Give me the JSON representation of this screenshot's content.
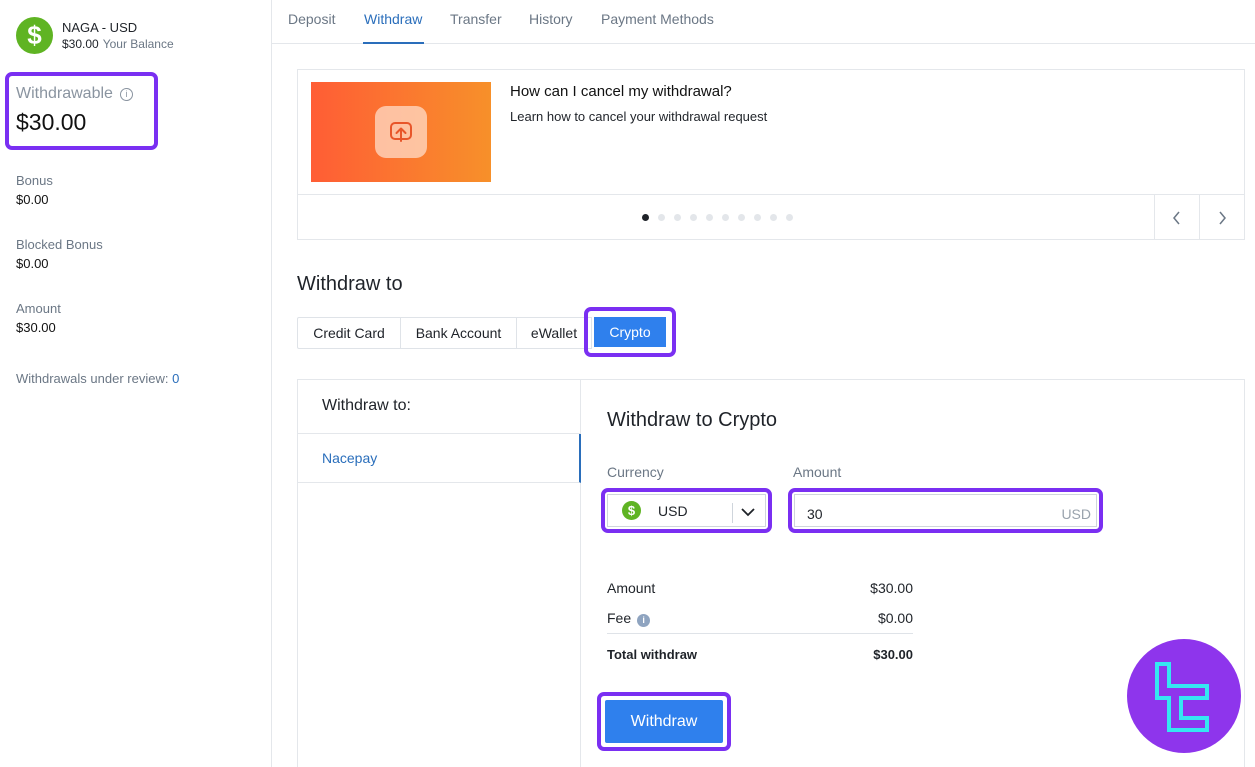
{
  "sidebar": {
    "account_name": "NAGA - USD",
    "balance": "$30.00",
    "balance_label": "Your Balance",
    "withdrawable_label": "Withdrawable",
    "withdrawable_value": "$30.00",
    "bonus_label": "Bonus",
    "bonus_value": "$0.00",
    "blocked_label": "Blocked Bonus",
    "blocked_value": "$0.00",
    "amount_label": "Amount",
    "amount_value": "$30.00",
    "review_label": "Withdrawals under review:",
    "review_count": "0"
  },
  "tabs": [
    "Deposit",
    "Withdraw",
    "Transfer",
    "History",
    "Payment Methods"
  ],
  "active_tab": "Withdraw",
  "carousel": {
    "title": "How can I cancel my withdrawal?",
    "subtitle": "Learn how to cancel your withdrawal request",
    "page_count": 10,
    "current_page": 1
  },
  "withdraw": {
    "section_title": "Withdraw to",
    "methods": [
      "Credit Card",
      "Bank Account",
      "eWallet",
      "Crypto"
    ],
    "selected_method": "Crypto",
    "list_header": "Withdraw to:",
    "list_items": [
      "Nacepay"
    ],
    "form_title": "Withdraw to Crypto",
    "currency_label": "Currency",
    "currency_value": "USD",
    "amount_label": "Amount",
    "amount_value": "30",
    "amount_unit": "USD",
    "summary": {
      "amount_label": "Amount",
      "amount_value": "$30.00",
      "fee_label": "Fee",
      "fee_value": "$0.00",
      "total_label": "Total withdraw",
      "total_value": "$30.00"
    },
    "submit_label": "Withdraw"
  },
  "colors": {
    "accent": "#2f80ed",
    "link": "#2a6ebb",
    "highlight": "#7a2ff2",
    "currency_green": "#5fb423",
    "logo_purple": "#8e35ec"
  }
}
